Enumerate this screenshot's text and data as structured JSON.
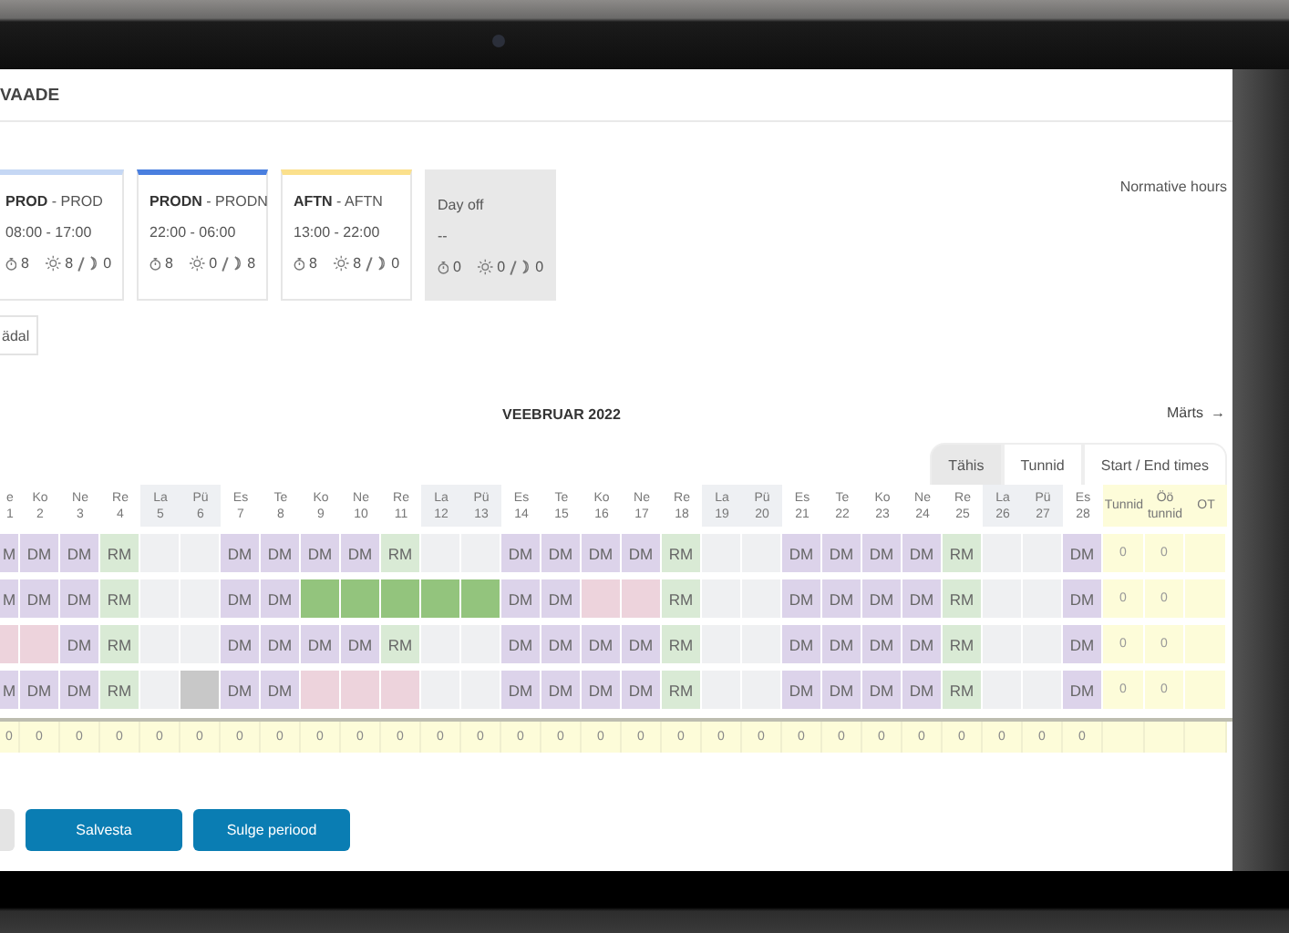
{
  "page": {
    "title": "VAADE"
  },
  "shift_types": [
    {
      "kind": "shift",
      "label": "**PROD** - PROD",
      "time": "08:00 - 17:00",
      "hours": "8",
      "day_hours": "8",
      "night_hours": "0",
      "color": "#c5d7f4"
    },
    {
      "kind": "shift",
      "label": "**PRODN** - PRODN",
      "time": "22:00 - 06:00",
      "hours": "8",
      "day_hours": "0",
      "night_hours": "8",
      "color": "#4a7fdf"
    },
    {
      "kind": "shift",
      "label": "**AFTN** - AFTN",
      "time": "13:00 - 22:00",
      "hours": "8",
      "day_hours": "8",
      "night_hours": "0",
      "color": "#fbe08c"
    },
    {
      "kind": "off",
      "label": "Day off",
      "time": "--",
      "hours": "0",
      "day_hours": "0",
      "night_hours": "0"
    }
  ],
  "normative_hours_label": "Normative hours",
  "view_button": "ädal",
  "month": "VEEBRUAR 2022",
  "next_month": {
    "label": "Märts",
    "arrow": "→"
  },
  "view_tabs": [
    {
      "label": "Tähis",
      "selected": true
    },
    {
      "label": "Tunnid",
      "selected": false
    },
    {
      "label": "Start / End times",
      "selected": false
    }
  ],
  "days": [
    {
      "weekday": "e",
      "date": "1",
      "weekend": false
    },
    {
      "weekday": "Ko",
      "date": "2",
      "weekend": false
    },
    {
      "weekday": "Ne",
      "date": "3",
      "weekend": false
    },
    {
      "weekday": "Re",
      "date": "4",
      "weekend": false
    },
    {
      "weekday": "La",
      "date": "5",
      "weekend": true
    },
    {
      "weekday": "Pü",
      "date": "6",
      "weekend": true
    },
    {
      "weekday": "Es",
      "date": "7",
      "weekend": false
    },
    {
      "weekday": "Te",
      "date": "8",
      "weekend": false
    },
    {
      "weekday": "Ko",
      "date": "9",
      "weekend": false
    },
    {
      "weekday": "Ne",
      "date": "10",
      "weekend": false
    },
    {
      "weekday": "Re",
      "date": "11",
      "weekend": false
    },
    {
      "weekday": "La",
      "date": "12",
      "weekend": true
    },
    {
      "weekday": "Pü",
      "date": "13",
      "weekend": true
    },
    {
      "weekday": "Es",
      "date": "14",
      "weekend": false
    },
    {
      "weekday": "Te",
      "date": "15",
      "weekend": false
    },
    {
      "weekday": "Ko",
      "date": "16",
      "weekend": false
    },
    {
      "weekday": "Ne",
      "date": "17",
      "weekend": false
    },
    {
      "weekday": "Re",
      "date": "18",
      "weekend": false
    },
    {
      "weekday": "La",
      "date": "19",
      "weekend": true
    },
    {
      "weekday": "Pü",
      "date": "20",
      "weekend": true
    },
    {
      "weekday": "Es",
      "date": "21",
      "weekend": false
    },
    {
      "weekday": "Te",
      "date": "22",
      "weekend": false
    },
    {
      "weekday": "Ko",
      "date": "23",
      "weekend": false
    },
    {
      "weekday": "Ne",
      "date": "24",
      "weekend": false
    },
    {
      "weekday": "Re",
      "date": "25",
      "weekend": false
    },
    {
      "weekday": "La",
      "date": "26",
      "weekend": true
    },
    {
      "weekday": "Pü",
      "date": "27",
      "weekend": true
    },
    {
      "weekday": "Es",
      "date": "28",
      "weekend": false
    }
  ],
  "summary_columns": [
    "Tunnid",
    "Öö tunnid",
    "OT"
  ],
  "rows": [
    {
      "cells": [
        {
          "kind": "dm",
          "code": "M"
        },
        {
          "kind": "dm",
          "code": "DM"
        },
        {
          "kind": "dm",
          "code": "DM"
        },
        {
          "kind": "rm",
          "code": "RM"
        },
        {
          "kind": "empty"
        },
        {
          "kind": "empty"
        },
        {
          "kind": "dm",
          "code": "DM"
        },
        {
          "kind": "dm",
          "code": "DM"
        },
        {
          "kind": "dm",
          "code": "DM"
        },
        {
          "kind": "dm",
          "code": "DM"
        },
        {
          "kind": "rm",
          "code": "RM"
        },
        {
          "kind": "empty"
        },
        {
          "kind": "empty"
        },
        {
          "kind": "dm",
          "code": "DM"
        },
        {
          "kind": "dm",
          "code": "DM"
        },
        {
          "kind": "dm",
          "code": "DM"
        },
        {
          "kind": "dm",
          "code": "DM"
        },
        {
          "kind": "rm",
          "code": "RM"
        },
        {
          "kind": "empty"
        },
        {
          "kind": "empty"
        },
        {
          "kind": "dm",
          "code": "DM"
        },
        {
          "kind": "dm",
          "code": "DM"
        },
        {
          "kind": "dm",
          "code": "DM"
        },
        {
          "kind": "dm",
          "code": "DM"
        },
        {
          "kind": "rm",
          "code": "RM"
        },
        {
          "kind": "empty"
        },
        {
          "kind": "empty"
        },
        {
          "kind": "dm",
          "code": "DM"
        }
      ],
      "totals": [
        "0",
        "0"
      ]
    },
    {
      "cells": [
        {
          "kind": "dm",
          "code": "M"
        },
        {
          "kind": "dm",
          "code": "DM"
        },
        {
          "kind": "dm",
          "code": "DM"
        },
        {
          "kind": "rm",
          "code": "RM"
        },
        {
          "kind": "empty"
        },
        {
          "kind": "empty"
        },
        {
          "kind": "dm",
          "code": "DM"
        },
        {
          "kind": "dm",
          "code": "DM"
        },
        {
          "kind": "leave"
        },
        {
          "kind": "leave"
        },
        {
          "kind": "leave"
        },
        {
          "kind": "leave"
        },
        {
          "kind": "leave"
        },
        {
          "kind": "dm",
          "code": "DM"
        },
        {
          "kind": "dm",
          "code": "DM"
        },
        {
          "kind": "absence"
        },
        {
          "kind": "absence"
        },
        {
          "kind": "rm",
          "code": "RM"
        },
        {
          "kind": "empty"
        },
        {
          "kind": "empty"
        },
        {
          "kind": "dm",
          "code": "DM"
        },
        {
          "kind": "dm",
          "code": "DM"
        },
        {
          "kind": "dm",
          "code": "DM"
        },
        {
          "kind": "dm",
          "code": "DM"
        },
        {
          "kind": "rm",
          "code": "RM"
        },
        {
          "kind": "empty"
        },
        {
          "kind": "empty"
        },
        {
          "kind": "dm",
          "code": "DM"
        }
      ],
      "totals": [
        "0",
        "0"
      ]
    },
    {
      "cells": [
        {
          "kind": "absence"
        },
        {
          "kind": "absence"
        },
        {
          "kind": "dm",
          "code": "DM"
        },
        {
          "kind": "rm",
          "code": "RM"
        },
        {
          "kind": "empty"
        },
        {
          "kind": "empty"
        },
        {
          "kind": "dm",
          "code": "DM"
        },
        {
          "kind": "dm",
          "code": "DM"
        },
        {
          "kind": "dm",
          "code": "DM"
        },
        {
          "kind": "dm",
          "code": "DM"
        },
        {
          "kind": "rm",
          "code": "RM"
        },
        {
          "kind": "empty"
        },
        {
          "kind": "empty"
        },
        {
          "kind": "dm",
          "code": "DM"
        },
        {
          "kind": "dm",
          "code": "DM"
        },
        {
          "kind": "dm",
          "code": "DM"
        },
        {
          "kind": "dm",
          "code": "DM"
        },
        {
          "kind": "rm",
          "code": "RM"
        },
        {
          "kind": "empty"
        },
        {
          "kind": "empty"
        },
        {
          "kind": "dm",
          "code": "DM"
        },
        {
          "kind": "dm",
          "code": "DM"
        },
        {
          "kind": "dm",
          "code": "DM"
        },
        {
          "kind": "dm",
          "code": "DM"
        },
        {
          "kind": "rm",
          "code": "RM"
        },
        {
          "kind": "empty"
        },
        {
          "kind": "empty"
        },
        {
          "kind": "dm",
          "code": "DM"
        }
      ],
      "totals": [
        "0",
        "0"
      ]
    },
    {
      "cells": [
        {
          "kind": "dm",
          "code": "M"
        },
        {
          "kind": "dm",
          "code": "DM"
        },
        {
          "kind": "dm",
          "code": "DM"
        },
        {
          "kind": "rm",
          "code": "RM"
        },
        {
          "kind": "empty"
        },
        {
          "kind": "blocked"
        },
        {
          "kind": "dm",
          "code": "DM"
        },
        {
          "kind": "dm",
          "code": "DM"
        },
        {
          "kind": "absence"
        },
        {
          "kind": "absence"
        },
        {
          "kind": "absence"
        },
        {
          "kind": "empty"
        },
        {
          "kind": "empty"
        },
        {
          "kind": "dm",
          "code": "DM"
        },
        {
          "kind": "dm",
          "code": "DM"
        },
        {
          "kind": "dm",
          "code": "DM"
        },
        {
          "kind": "dm",
          "code": "DM"
        },
        {
          "kind": "rm",
          "code": "RM"
        },
        {
          "kind": "empty"
        },
        {
          "kind": "empty"
        },
        {
          "kind": "dm",
          "code": "DM"
        },
        {
          "kind": "dm",
          "code": "DM"
        },
        {
          "kind": "dm",
          "code": "DM"
        },
        {
          "kind": "dm",
          "code": "DM"
        },
        {
          "kind": "rm",
          "code": "RM"
        },
        {
          "kind": "empty"
        },
        {
          "kind": "empty"
        },
        {
          "kind": "dm",
          "code": "DM"
        }
      ],
      "totals": [
        "0",
        "0"
      ]
    }
  ],
  "totals_row": [
    "0",
    "0",
    "0",
    "0",
    "0",
    "0",
    "0",
    "0",
    "0",
    "0",
    "0",
    "0",
    "0",
    "0",
    "0",
    "0",
    "0",
    "0",
    "0",
    "0",
    "0",
    "0",
    "0",
    "0",
    "0",
    "0",
    "0",
    "0"
  ],
  "buttons": [
    {
      "kind": "secondary"
    },
    {
      "kind": "primary",
      "label": "Salvesta"
    },
    {
      "kind": "primary",
      "label": "Sulge periood"
    }
  ]
}
